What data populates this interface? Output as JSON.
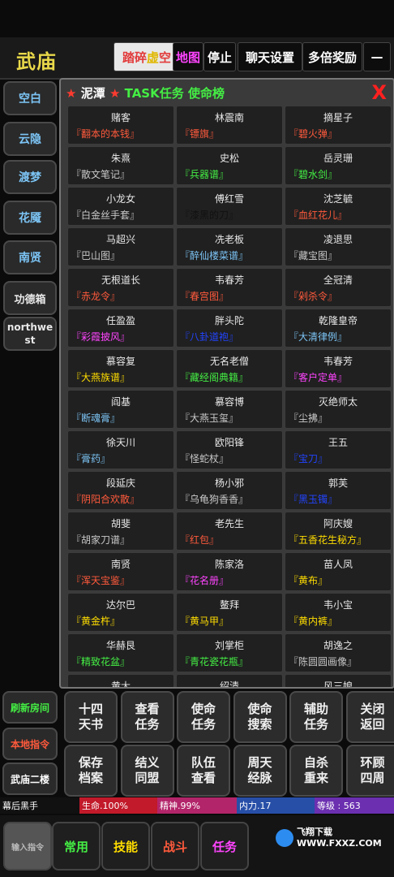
{
  "header": {
    "title": "武庙",
    "buttons": [
      {
        "label": "踏碎虚空",
        "color": "#ffdd00"
      },
      {
        "label": "地图",
        "color": "#ff44ff"
      },
      {
        "label": "停止",
        "color": "#ffffff"
      },
      {
        "label": "聊天设置",
        "color": "#ffffff"
      },
      {
        "label": "多倍奖励",
        "color": "#ffffff"
      },
      {
        "label": "—",
        "color": "#ffffff"
      }
    ]
  },
  "sidebar": {
    "items": [
      {
        "label": "空白"
      },
      {
        "label": "云隐"
      },
      {
        "label": "渡梦"
      },
      {
        "label": "花魇"
      },
      {
        "label": "南贤"
      },
      {
        "label": "功德箱"
      },
      {
        "label": "northwest"
      }
    ]
  },
  "panel": {
    "location": "泥潭",
    "heading": "TASK任务 使命榜",
    "close_label": "X",
    "cells": [
      {
        "name": "赌客",
        "item": "『翻本的本钱』",
        "color": "#ff5a3c"
      },
      {
        "name": "林震南",
        "item": "『镖旗』",
        "color": "#ff5a3c"
      },
      {
        "name": "摘星子",
        "item": "『碧火弹』",
        "color": "#ff5a3c"
      },
      {
        "name": "朱熹",
        "item": "『散文笔记』",
        "color": "#c8c8c8"
      },
      {
        "name": "史松",
        "item": "『兵器谱』",
        "color": "#44ee44"
      },
      {
        "name": "岳灵珊",
        "item": "『碧水剑』",
        "color": "#44ee44"
      },
      {
        "name": "小龙女",
        "item": "『白金丝手套』",
        "color": "#c8c8c8"
      },
      {
        "name": "傅红雪",
        "item": "『漆黑的刀』",
        "color": "#111111"
      },
      {
        "name": "沈芝毓",
        "item": "『血红花儿』",
        "color": "#ff5a3c"
      },
      {
        "name": "马超兴",
        "item": "『巴山图』",
        "color": "#c8c8c8"
      },
      {
        "name": "冼老板",
        "item": "『醉仙楼菜谱』",
        "color": "#7cc4f5"
      },
      {
        "name": "凌退思",
        "item": "『藏宝图』",
        "color": "#c8c8c8"
      },
      {
        "name": "无根道长",
        "item": "『赤龙令』",
        "color": "#ff5a3c"
      },
      {
        "name": "韦春芳",
        "item": "『春宫图』",
        "color": "#ff5a3c"
      },
      {
        "name": "全冠清",
        "item": "『剁杀令』",
        "color": "#ff5a3c"
      },
      {
        "name": "任盈盈",
        "item": "『彩霞披风』",
        "color": "#ff44ff"
      },
      {
        "name": "胖头陀",
        "item": "『八卦道袍』",
        "color": "#2244ff"
      },
      {
        "name": "乾隆皇帝",
        "item": "『大清律例』",
        "color": "#7cc4f5"
      },
      {
        "name": "慕容复",
        "item": "『大燕族谱』",
        "color": "#ffdd00"
      },
      {
        "name": "无名老僧",
        "item": "『藏经阁典籍』",
        "color": "#44ee44"
      },
      {
        "name": "韦春芳",
        "item": "『客户定单』",
        "color": "#ff44ff"
      },
      {
        "name": "阎基",
        "item": "『断魂膏』",
        "color": "#7cc4f5"
      },
      {
        "name": "慕容博",
        "item": "『大燕玉玺』",
        "color": "#c8c8c8"
      },
      {
        "name": "灭绝师太",
        "item": "『尘拂』",
        "color": "#c8c8c8"
      },
      {
        "name": "徐天川",
        "item": "『膏药』",
        "color": "#7cc4f5"
      },
      {
        "name": "欧阳锋",
        "item": "『怪蛇杖』",
        "color": "#c8c8c8"
      },
      {
        "name": "王五",
        "item": "『宝刀』",
        "color": "#2244ff"
      },
      {
        "name": "段延庆",
        "item": "『阴阳合欢散』",
        "color": "#ff5a3c"
      },
      {
        "name": "杨小邪",
        "item": "『乌龟狗香香』",
        "color": "#c8c8c8"
      },
      {
        "name": "郭芙",
        "item": "『黑玉镯』",
        "color": "#2244ff"
      },
      {
        "name": "胡斐",
        "item": "『胡家刀谱』",
        "color": "#c8c8c8"
      },
      {
        "name": "老先生",
        "item": "『红包』",
        "color": "#ff5a3c"
      },
      {
        "name": "阿庆嫂",
        "item": "『五香花生秘方』",
        "color": "#ffdd00"
      },
      {
        "name": "南贤",
        "item": "『浑天宝鉴』",
        "color": "#ff5a3c"
      },
      {
        "name": "陈家洛",
        "item": "『花名册』",
        "color": "#ff44ff"
      },
      {
        "name": "苗人凤",
        "item": "『黄布』",
        "color": "#ffdd00"
      },
      {
        "name": "达尔巴",
        "item": "『黄金杵』",
        "color": "#ffdd00"
      },
      {
        "name": "鳌拜",
        "item": "『黄马甲』",
        "color": "#ffdd00"
      },
      {
        "name": "韦小宝",
        "item": "『黄内裤』",
        "color": "#ffdd00"
      },
      {
        "name": "华赫艮",
        "item": "『精致花盆』",
        "color": "#44ee44"
      },
      {
        "name": "刘掌柜",
        "item": "『青花瓷花瓶』",
        "color": "#44ee44"
      },
      {
        "name": "胡逸之",
        "item": "『陈圆圆画像』",
        "color": "#c8c8c8"
      },
      {
        "name": "黄大",
        "item": "",
        "color": "#c8c8c8"
      },
      {
        "name": "绍清",
        "item": "",
        "color": "#c8c8c8"
      },
      {
        "name": "风三娘",
        "item": "",
        "color": "#c8c8c8"
      }
    ]
  },
  "left_actions": [
    {
      "label": "刷新房间",
      "color": "#44ee44"
    },
    {
      "label": "本地指令",
      "color": "#ff5a3c"
    },
    {
      "label": "武庙二楼",
      "color": "#ffffff"
    }
  ],
  "commands": [
    {
      "label": "十四\n天书"
    },
    {
      "label": "查看\n任务"
    },
    {
      "label": "使命\n任务"
    },
    {
      "label": "使命\n搜索"
    },
    {
      "label": "辅助\n任务"
    },
    {
      "label": "关闭\n返回"
    },
    {
      "label": "保存\n档案"
    },
    {
      "label": "结义\n同盟"
    },
    {
      "label": "队伍\n查看"
    },
    {
      "label": "周天\n经脉"
    },
    {
      "label": "自杀\n重来"
    },
    {
      "label": "环顾\n四周"
    }
  ],
  "status": [
    {
      "label": "幕后黑手",
      "bg": "#111111"
    },
    {
      "label": "生命.100%",
      "bg": "#c21a2a"
    },
    {
      "label": "精神.99%",
      "bg": "#b3256a"
    },
    {
      "label": "内力.17",
      "bg": "#274fa8"
    },
    {
      "label": "等级 : 563",
      "bg": "#6b2fb0"
    }
  ],
  "bottom_bar": [
    {
      "label": "输入指令",
      "color": "#bbbbbb"
    },
    {
      "label": "常用",
      "color": "#44ee44"
    },
    {
      "label": "技能",
      "color": "#ffdd00"
    },
    {
      "label": "战斗",
      "color": "#ff5a3c"
    },
    {
      "label": "任务",
      "color": "#ff44ff"
    },
    {
      "label": "",
      "color": "#ffffff"
    },
    {
      "label": "",
      "color": "#ffffff"
    },
    {
      "label": "",
      "color": "#ffffff"
    }
  ],
  "watermark": "飞翔下载 WWW.FXXZ.COM"
}
